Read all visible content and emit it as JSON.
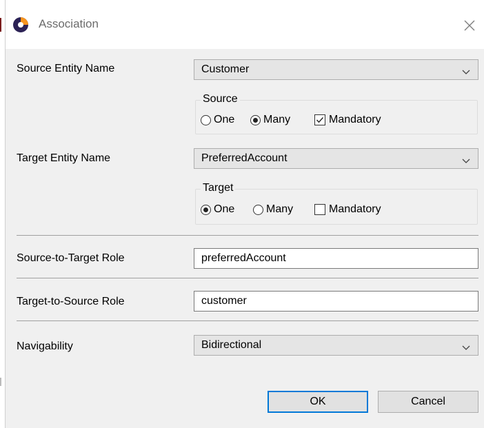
{
  "window": {
    "title": "Association"
  },
  "form": {
    "source_entity": {
      "label": "Source Entity Name",
      "value": "Customer"
    },
    "source_group": {
      "title": "Source",
      "options": [
        {
          "label": "One",
          "selected": false
        },
        {
          "label": "Many",
          "selected": true
        }
      ],
      "mandatory": {
        "label": "Mandatory",
        "checked": true
      }
    },
    "target_entity": {
      "label": "Target Entity Name",
      "value": "PreferredAccount"
    },
    "target_group": {
      "title": "Target",
      "options": [
        {
          "label": "One",
          "selected": true
        },
        {
          "label": "Many",
          "selected": false
        }
      ],
      "mandatory": {
        "label": "Mandatory",
        "checked": false
      }
    },
    "source_to_target_role": {
      "label": "Source-to-Target Role",
      "value": "preferredAccount"
    },
    "target_to_source_role": {
      "label": "Target-to-Source Role",
      "value": "customer"
    },
    "navigability": {
      "label": "Navigability",
      "value": "Bidirectional"
    }
  },
  "buttons": {
    "ok": "OK",
    "cancel": "Cancel"
  },
  "colors": {
    "default_button_border": "#0078d7",
    "dialog_bg": "#f0f0f0"
  },
  "icons": {
    "app": "eclipse-app-icon",
    "close": "close-icon",
    "dropdown": "chevron-down-icon"
  }
}
